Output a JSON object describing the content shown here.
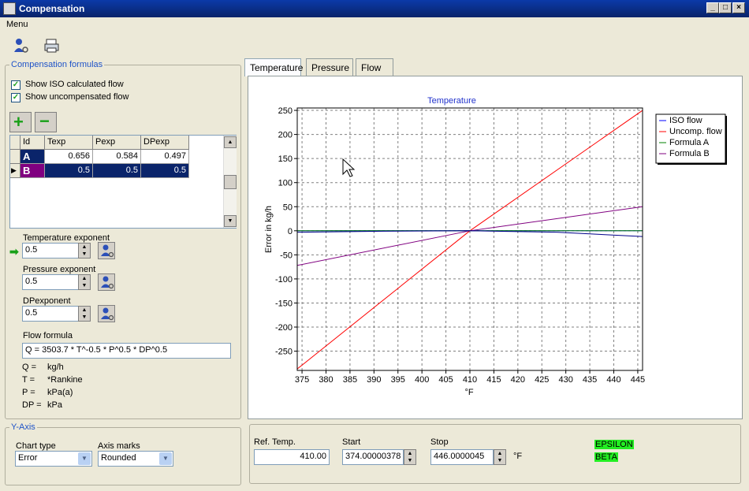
{
  "window": {
    "title": "Compensation",
    "min": "_",
    "max": "□",
    "close": "×"
  },
  "menu": {
    "label": "Menu"
  },
  "formulas": {
    "group_title": "Compensation formulas",
    "show_iso": "Show ISO calculated flow",
    "show_uncomp": "Show uncompensated flow",
    "add": "+",
    "remove": "−",
    "columns": [
      "Id",
      "Texp",
      "Pexp",
      "DPexp"
    ],
    "rows": [
      {
        "id": "A",
        "texp": "0.656",
        "pexp": "0.584",
        "dpexp": "0.497"
      },
      {
        "id": "B",
        "texp": "0.5",
        "pexp": "0.5",
        "dpexp": "0.5"
      }
    ],
    "temp_exp_label": "Temperature exponent",
    "temp_exp": "0.5",
    "press_exp_label": "Pressure exponent",
    "press_exp": "0.5",
    "dp_exp_label": "DPexponent",
    "dp_exp": "0.5",
    "flow_label": "Flow formula",
    "flow_formula": "Q = 3503.7 * T^-0.5 * P^0.5 * DP^0.5",
    "units": [
      {
        "sym": "Q =",
        "unit": "kg/h"
      },
      {
        "sym": "T =",
        "unit": "*Rankine"
      },
      {
        "sym": "P =",
        "unit": "kPa(a)"
      },
      {
        "sym": "DP =",
        "unit": "kPa"
      }
    ]
  },
  "yaxis": {
    "group_title": "Y-Axis",
    "chart_type_label": "Chart type",
    "chart_type": "Error",
    "axis_marks_label": "Axis marks",
    "axis_marks": "Rounded"
  },
  "tabs": [
    "Temperature",
    "Pressure",
    "Flow"
  ],
  "bottom": {
    "ref_label": "Ref. Temp.",
    "ref_value": "410.00",
    "start_label": "Start",
    "start_value": "374.00000378",
    "stop_label": "Stop",
    "stop_value": "446.0000045",
    "unit": "°F",
    "status1": "EPSILON",
    "status2": "BETA"
  },
  "chart_data": {
    "type": "line",
    "title": "Temperature",
    "xlabel": "°F",
    "ylabel": "Error in kg/h",
    "xlim": [
      374,
      446
    ],
    "ylim": [
      -290,
      255
    ],
    "xticks": [
      375,
      380,
      385,
      390,
      395,
      400,
      405,
      410,
      415,
      420,
      425,
      430,
      435,
      440,
      445
    ],
    "yticks": [
      250,
      200,
      150,
      100,
      50,
      0,
      -50,
      -100,
      -150,
      -200,
      -250
    ],
    "grid": true,
    "legend_position": "right",
    "series": [
      {
        "name": "ISO flow",
        "color": "#0000ff",
        "x": [
          374,
          410,
          446
        ],
        "y": [
          0,
          0,
          0
        ]
      },
      {
        "name": "Uncomp. flow",
        "color": "#ff0000",
        "x": [
          374,
          410,
          446
        ],
        "y": [
          -287,
          0,
          250
        ]
      },
      {
        "name": "Formula A",
        "color": "#008000",
        "x": [
          374,
          410,
          446
        ],
        "y": [
          0,
          0,
          0
        ]
      },
      {
        "name": "Formula B",
        "color": "#800080",
        "x": [
          374,
          410,
          446
        ],
        "y": [
          -72,
          0,
          50
        ]
      },
      {
        "name": "",
        "color": "#00008b",
        "x": [
          374,
          392,
          410,
          428,
          446
        ],
        "y": [
          -3,
          -1,
          0,
          -3,
          -12
        ]
      }
    ]
  }
}
